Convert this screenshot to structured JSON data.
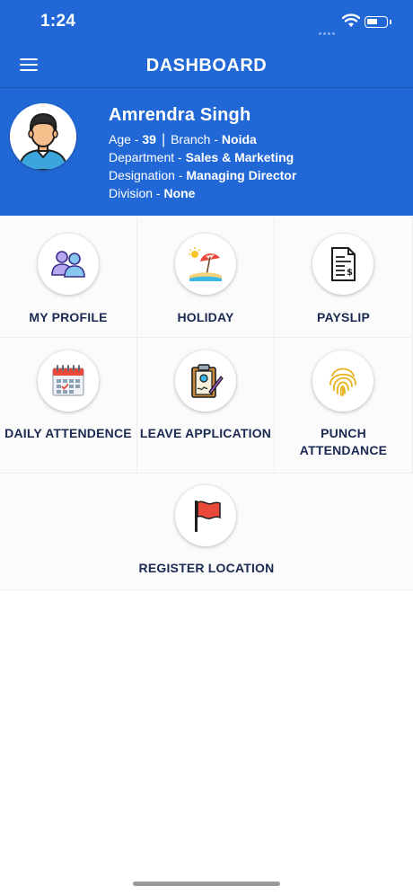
{
  "status_bar": {
    "time": "1:24"
  },
  "header": {
    "title": "DASHBOARD"
  },
  "profile": {
    "name": "Amrendra Singh",
    "age_label": "Age - ",
    "age": "39",
    "separator": "|",
    "branch_label": "Branch - ",
    "branch": "Noida",
    "department_label": "Department - ",
    "department": "Sales & Marketing",
    "designation_label": "Designation - ",
    "designation": "Managing Director",
    "division_label": "Division - ",
    "division": "None"
  },
  "tiles": [
    {
      "label": "MY PROFILE",
      "icon": "users-icon"
    },
    {
      "label": "HOLIDAY",
      "icon": "beach-umbrella-icon"
    },
    {
      "label": "PAYSLIP",
      "icon": "payslip-document-icon"
    },
    {
      "label": "DAILY ATTENDENCE",
      "icon": "calendar-icon"
    },
    {
      "label": "LEAVE APPLICATION",
      "icon": "clipboard-icon"
    },
    {
      "label_line1": "PUNCH",
      "label_line2": "ATTENDANCE",
      "icon": "fingerprint-icon"
    },
    {
      "label": "REGISTER LOCATION",
      "icon": "red-flag-icon"
    }
  ],
  "colors": {
    "primary": "#2168d6",
    "label": "#1b2a52",
    "tile_bg": "#fbfbfb"
  }
}
